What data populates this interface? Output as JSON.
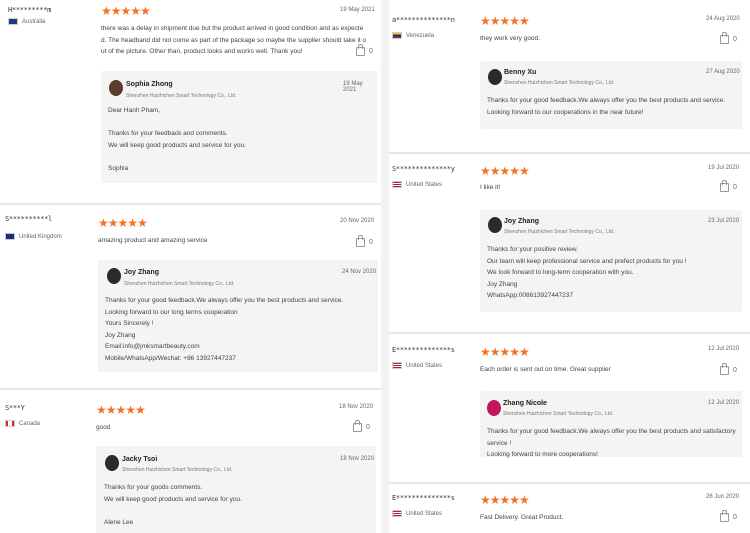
{
  "left": [
    {
      "user": "H*********m",
      "country": "Australia",
      "date": "19 May 2021",
      "stars": "★★★★★",
      "text_lines": [
        "there was a delay in shipment due but the product arrived in good condition and as expecte",
        "d. The headband did not come as part of the package so maybe the supplier should take it o",
        "ut of the picture. Other than, product looks and works well. Thank you!"
      ],
      "likes": "0",
      "reply": {
        "name": "Sophia Zhong",
        "company": "Shenzhen Huizhichen Smart Technology Co., Ltd.",
        "date": "19 May 2021",
        "text": "Dear Hanh Pham,\n\nThanks for your feedback and comments.\nWe will keep good products and service for you.\n\nSophia"
      }
    },
    {
      "user": "S**********l",
      "country": "United Kingdom",
      "date": "20 Nov 2020",
      "stars": "★★★★★",
      "text_lines": [
        "amazing product and amazing service"
      ],
      "likes": "0",
      "reply": {
        "name": "Joy Zhang",
        "company": "Shenzhen Huizhichen Smart Technology Co., Ltd.",
        "date": "24 Nov 2020",
        "text": "Thanks for your good feedback.We always offer you the best products and service.\nLooking forward to our long terms cooperation\nYours Sincerely !\nJoy Zhang\nEmail:info@jmksmartbeauty.com\nMobile/WhatsApp/Wechat: +86 13927447237"
      }
    },
    {
      "user": "S***Y",
      "country": "Canada",
      "date": "18 Nov 2020",
      "stars": "★★★★★",
      "text_lines": [
        "good"
      ],
      "likes": "0",
      "reply": {
        "name": "Jacky Tsoi",
        "company": "Shenzhen Huizhichen Smart Technology Co., Ltd.",
        "date": "18 Nov 2020",
        "text": "Thanks for your goods comments.\nWe will keep good products and service for you.\n\nAlene Lee"
      }
    }
  ],
  "right": [
    {
      "user": "a**************n",
      "country": "Venezuela",
      "date": "24 Aug 2020",
      "stars": "★★★★★",
      "text_lines": [
        "they work very good."
      ],
      "likes": "0",
      "reply": {
        "name": "Benny Xu",
        "company": "Shenzhen Huizhichen Smart Technology Co., Ltd.",
        "date": "27 Aug 2020",
        "text": "Thanks for your good feedback.We always offer you the best products and service.\nLooking forward to our cooperations in the near future!"
      }
    },
    {
      "user": "S**************y",
      "country": "United States",
      "date": "19 Jul 2020",
      "stars": "★★★★★",
      "text_lines": [
        "I like it!"
      ],
      "likes": "0",
      "reply": {
        "name": "Joy Zhang",
        "company": "Shenzhen Huizhichen Smart Technology Co., Ltd.",
        "date": "23 Jul 2020",
        "text": "Thanks for your positive review.\nOur team will keep professional service and prefect products for you !\nWe look forward to long-term cooperation with you.\nJoy Zhang\nWhatsApp:008613927447237"
      }
    },
    {
      "user": "E**************s",
      "country": "United States",
      "date": "12 Jul 2020",
      "stars": "★★★★★",
      "text_lines": [
        "Each order is sent out on time. Great supplier"
      ],
      "likes": "0",
      "reply": {
        "name": "Zhang Nicole",
        "company": "Shenzhen Huizhichen Smart Technology Co., Ltd.",
        "date": "12 Jul 2020",
        "text": "Thanks for your good feedback.We always offer you the best products and satisfactory service !\nLooking forward to more cooperations!"
      }
    },
    {
      "user": "E**************s",
      "country": "United States",
      "date": "26 Jun 2020",
      "stars": "★★★★★",
      "text_lines": [
        "Fast Delivery. Great Product."
      ],
      "likes": "0",
      "reply": null
    }
  ],
  "colors": {
    "stars": "#f57224",
    "reply_bg": "#f4f4f4"
  },
  "icons": {
    "like": "thumbs-up-icon"
  }
}
